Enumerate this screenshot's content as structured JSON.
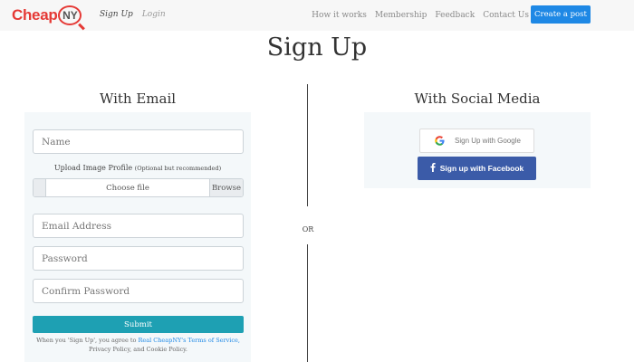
{
  "brand": {
    "logo_left": "Cheap",
    "logo_right": "NY"
  },
  "nav": {
    "signup": "Sign Up",
    "login": "Login",
    "links": [
      "How it works",
      "Membership",
      "Feedback",
      "Contact Us"
    ],
    "create_post": "Create a post"
  },
  "page": {
    "title": "Sign Up"
  },
  "email_section": {
    "title": "With Email",
    "name_placeholder": "Name",
    "upload_label": "Upload Image Profile",
    "upload_note": "(Optional but recommended)",
    "choose_file": "Choose file",
    "browse": "Browse",
    "email_placeholder": "Email Address",
    "password_placeholder": "Password",
    "confirm_placeholder": "Confirm Password",
    "submit": "Submit",
    "terms_prefix": "When you 'Sign Up', you agree to",
    "terms_link": "Real CheapNY's Terms of Service,",
    "terms_suffix": "Privacy Policy, and Cookie Policy."
  },
  "divider": {
    "or": "OR"
  },
  "social_section": {
    "title": "With Social Media",
    "google": "Sign Up with Google",
    "facebook": "Sign up with Facebook"
  },
  "colors": {
    "brand_red": "#e53935",
    "primary_blue": "#1e88e5",
    "submit_teal": "#1ea0b3",
    "facebook_blue": "#3b5ba8",
    "panel_bg": "#f4f8fa",
    "nav_bg": "#f7f7f7"
  }
}
